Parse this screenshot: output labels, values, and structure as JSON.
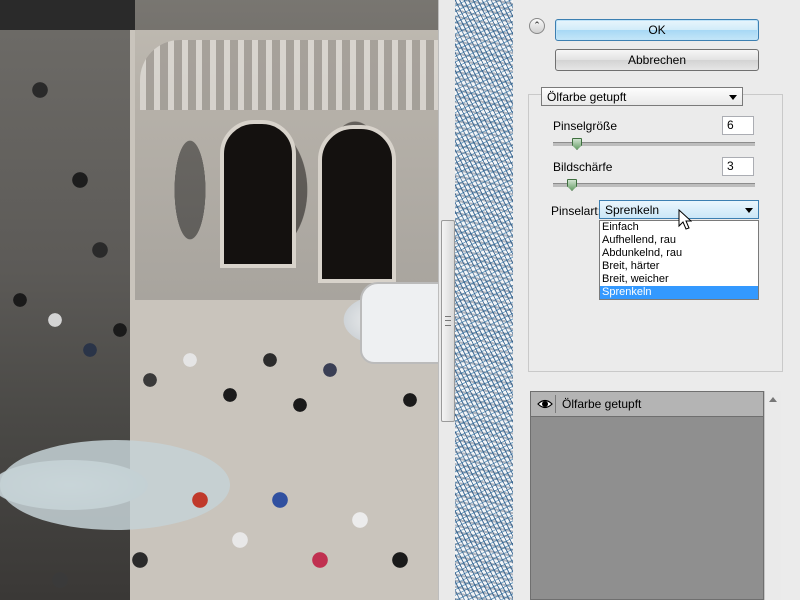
{
  "dialog": {
    "ok_label": "OK",
    "cancel_label": "Abbrechen",
    "collapse_icon": "double-chevron-up-icon"
  },
  "filter": {
    "selected": "Ölfarbe getupft"
  },
  "params": {
    "brush_size_label": "Pinselgröße",
    "brush_size_value": "6",
    "brush_size_level": 0.1,
    "sharpness_label": "Bildschärfe",
    "sharpness_value": "3",
    "sharpness_level": 0.07,
    "brush_type_label": "Pinselart:",
    "brush_type_selected": "Sprenkeln",
    "brush_type_options": [
      "Einfach",
      "Aufhellend, rau",
      "Abdunkelnd, rau",
      "Breit, härter",
      "Breit, weicher",
      "Sprenkeln"
    ]
  },
  "layers": {
    "items": [
      {
        "name": "Ölfarbe getupft",
        "visibility_icon": "eye-icon"
      }
    ]
  },
  "colors": {
    "ok_highlight": "#a7d8f5",
    "selected_option": "#3399ff"
  }
}
